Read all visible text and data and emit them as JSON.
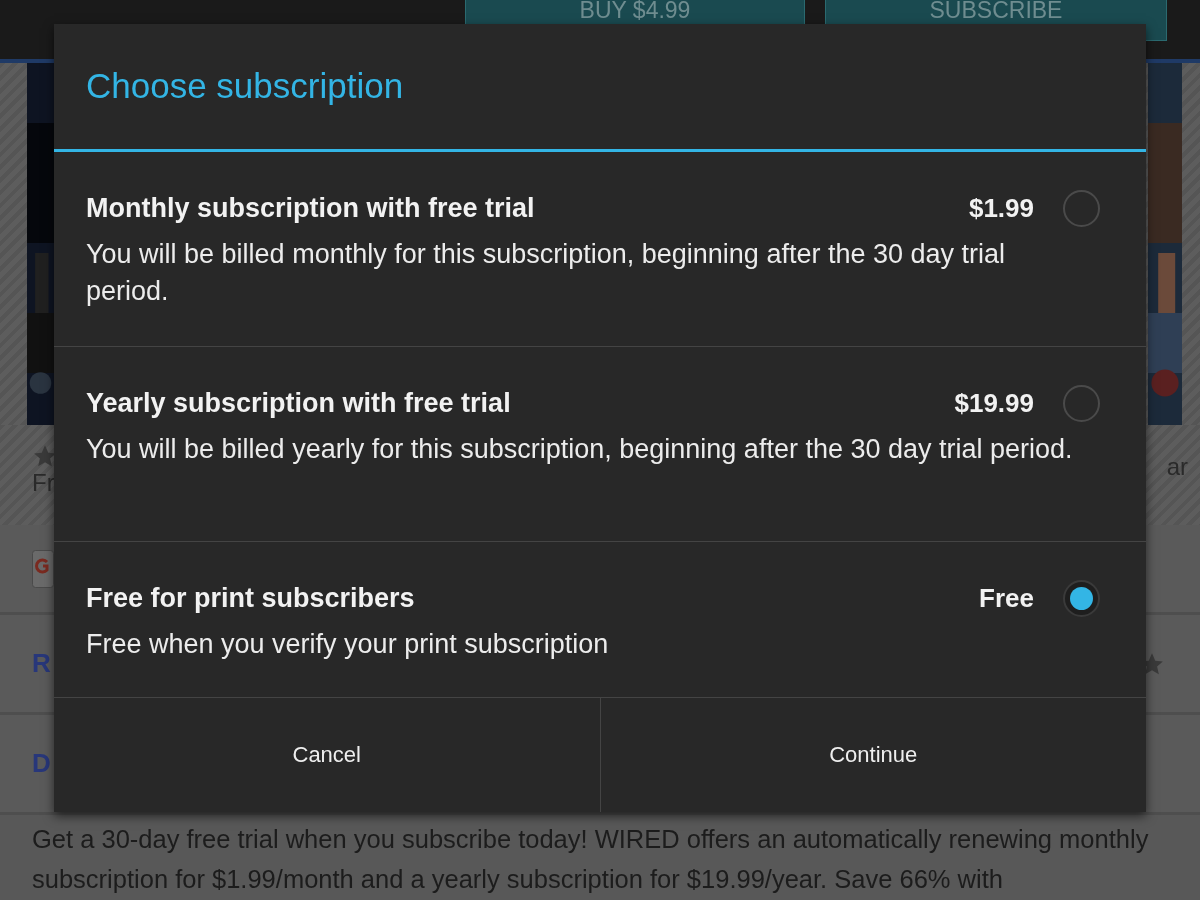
{
  "page": {
    "top_buttons": [
      {
        "label": "BUY $4.99"
      },
      {
        "label": "SUBSCRIBE"
      }
    ],
    "info_row": {
      "left_text": "Fr",
      "right_text": "ar"
    },
    "sections": [
      {
        "heading": "R"
      },
      {
        "heading": "D"
      }
    ],
    "description": "Get a 30-day free trial when you subscribe today! WIRED offers an automatically renewing monthly subscription for $1.99/month and a yearly subscription for $19.99/year. Save 66% with"
  },
  "dialog": {
    "title": "Choose subscription",
    "options": [
      {
        "title": "Monthly subscription with free trial",
        "price": "$1.99",
        "description": "You will be billed monthly for this subscription, beginning after the 30 day trial period.",
        "selected": false
      },
      {
        "title": "Yearly subscription with free trial",
        "price": "$19.99",
        "description": "You will be billed yearly for this subscription, beginning after the 30 day trial period.",
        "selected": false
      },
      {
        "title": "Free for print subscribers",
        "price": "Free",
        "description": "Free when you verify your print subscription",
        "selected": true
      }
    ],
    "buttons": [
      {
        "label": "Cancel"
      },
      {
        "label": "Continue"
      }
    ]
  }
}
